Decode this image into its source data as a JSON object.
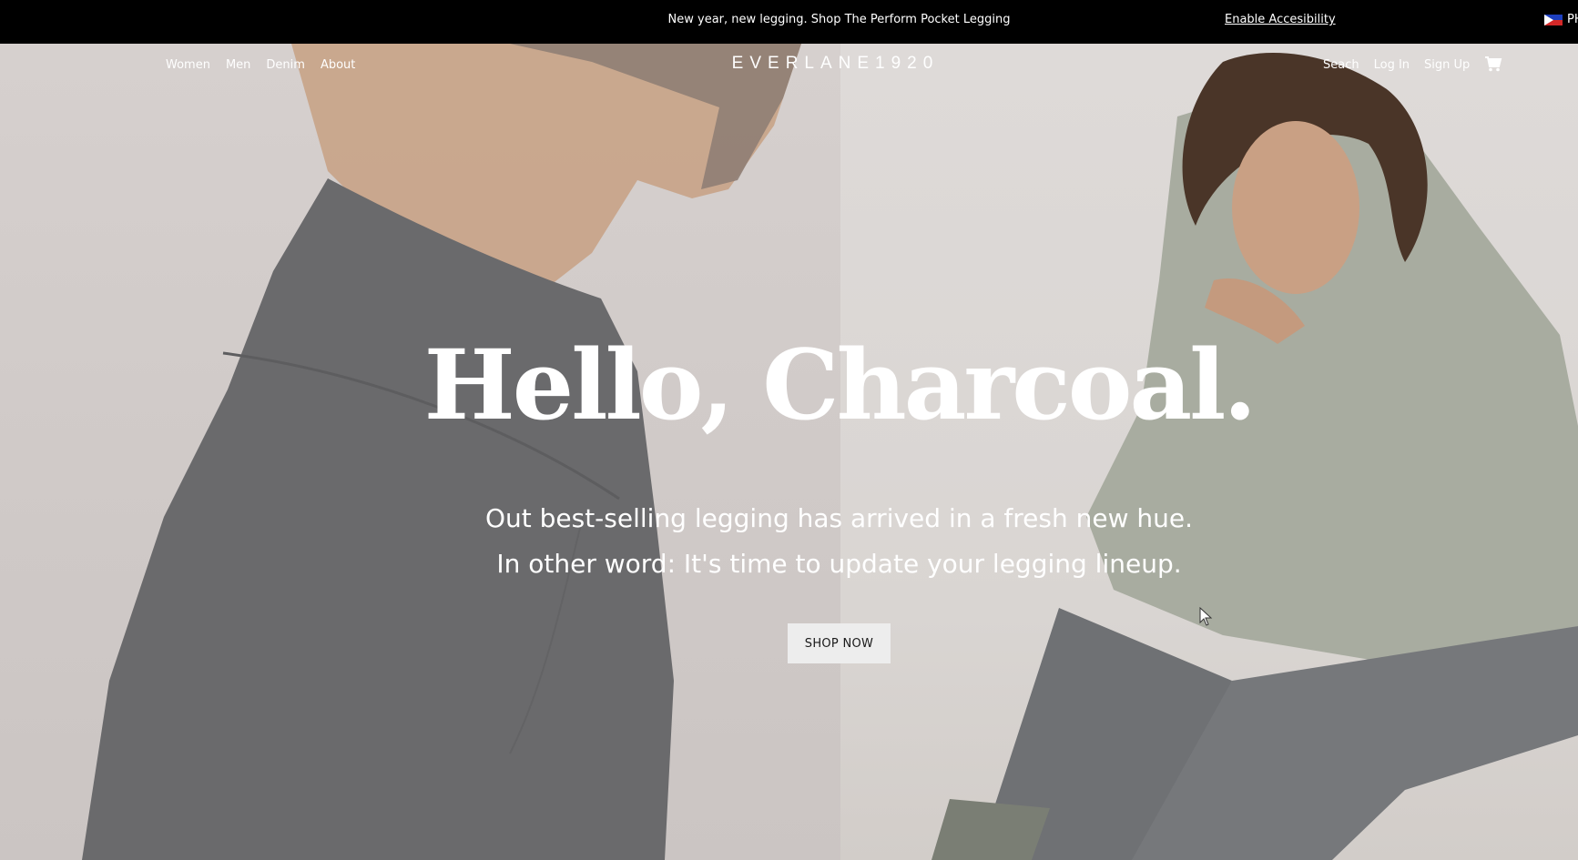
{
  "announcement": {
    "promo_text": "New year, new legging. Shop The Perform Pocket Legging",
    "accessibility_link": "Enable Accesibility",
    "country_code": "PH"
  },
  "nav": {
    "left_links": [
      "Women",
      "Men",
      "Denim",
      "About"
    ],
    "logo": "EVERLANE1920",
    "right_links": [
      "Seach",
      "Log In",
      "Sign Up"
    ],
    "cart_icon": "cart-icon"
  },
  "hero": {
    "headline": "Hello, Charcoal.",
    "subline_1": "Out best-selling legging has arrived in a fresh new hue.",
    "subline_2": "In other word: It's time to update your legging lineup.",
    "cta_label": "SHOP NOW"
  },
  "colors": {
    "topbar_bg": "#000000",
    "hero_text": "#ffffff",
    "cta_bg": "#ededed"
  }
}
